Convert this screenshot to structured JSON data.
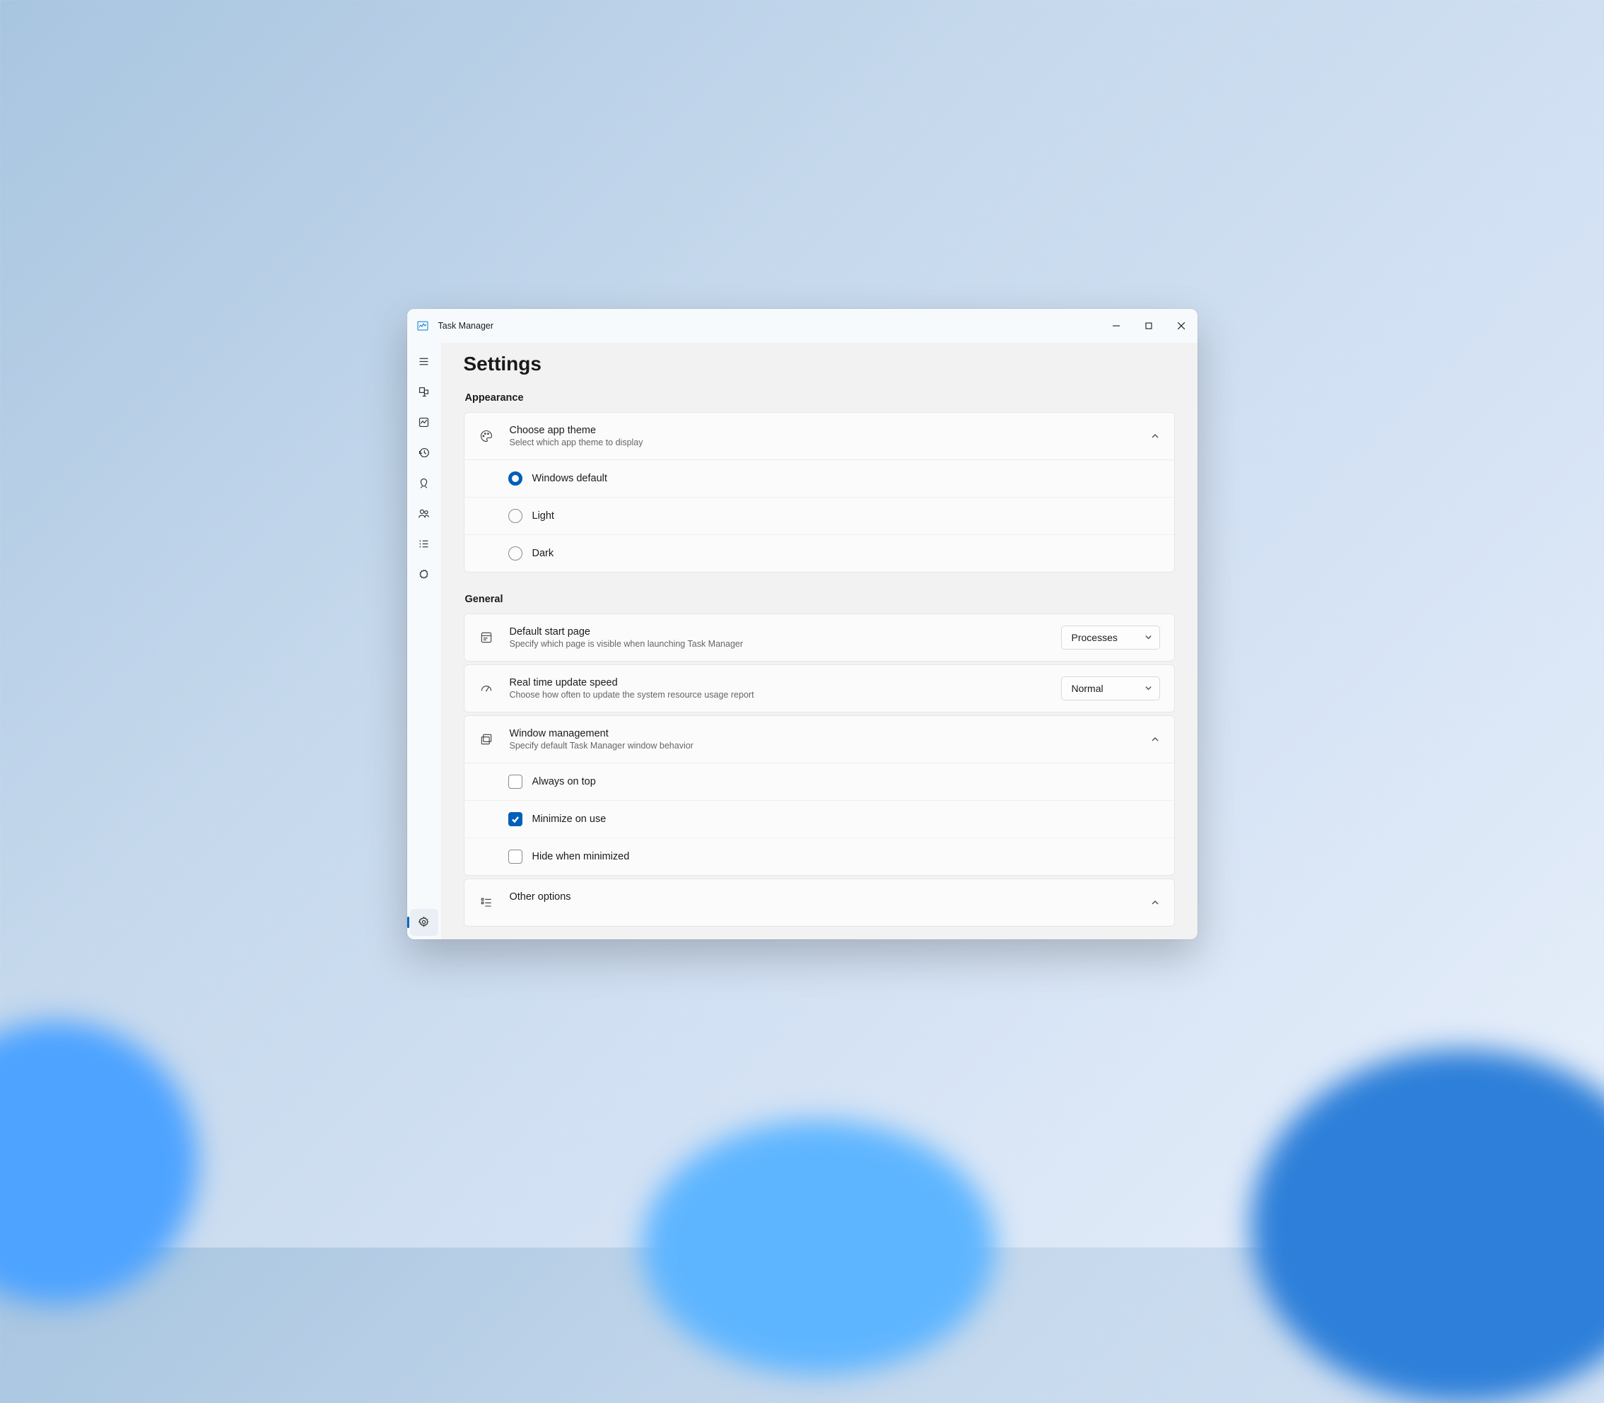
{
  "window": {
    "title": "Task Manager"
  },
  "page": {
    "title": "Settings"
  },
  "sections": {
    "appearance": {
      "label": "Appearance",
      "theme_card": {
        "title": "Choose app theme",
        "desc": "Select which app theme to display",
        "options": {
          "windows_default": "Windows default",
          "light": "Light",
          "dark": "Dark"
        }
      }
    },
    "general": {
      "label": "General",
      "start_page": {
        "title": "Default start page",
        "desc": "Specify which page is visible when launching Task Manager",
        "value": "Processes"
      },
      "update_speed": {
        "title": "Real time update speed",
        "desc": "Choose how often to update the system resource usage report",
        "value": "Normal"
      },
      "window_mgmt": {
        "title": "Window management",
        "desc": "Specify default Task Manager window behavior",
        "options": {
          "always_on_top": "Always on top",
          "minimize_on_use": "Minimize on use",
          "hide_when_minimized": "Hide when minimized"
        }
      },
      "other": {
        "title": "Other options"
      }
    }
  }
}
